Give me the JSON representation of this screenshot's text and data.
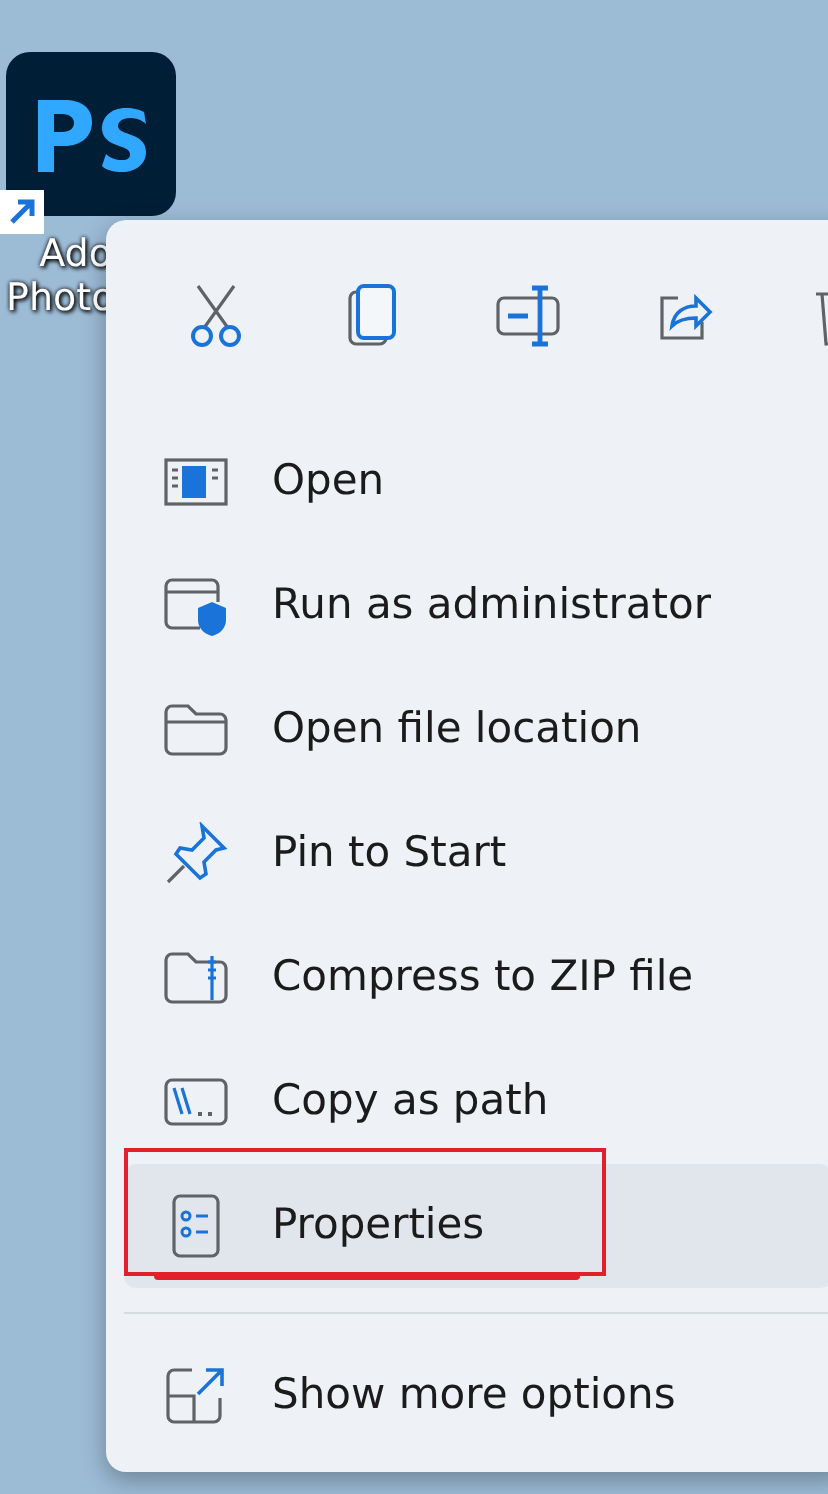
{
  "desktop_icon": {
    "label_lines": [
      "Ado",
      "Photo"
    ],
    "shortcut": true
  },
  "context_menu": {
    "items": [
      {
        "label": "Open",
        "selected": false,
        "highlighted": false
      },
      {
        "label": "Run as administrator",
        "selected": false,
        "highlighted": false
      },
      {
        "label": "Open file location",
        "selected": false,
        "highlighted": false
      },
      {
        "label": "Pin to Start",
        "selected": false,
        "highlighted": false
      },
      {
        "label": "Compress to ZIP file",
        "selected": false,
        "highlighted": false
      },
      {
        "label": "Copy as path",
        "selected": false,
        "highlighted": false
      },
      {
        "label": "Properties",
        "selected": true,
        "highlighted": true
      }
    ],
    "footer_item": {
      "label": "Show more options"
    }
  }
}
